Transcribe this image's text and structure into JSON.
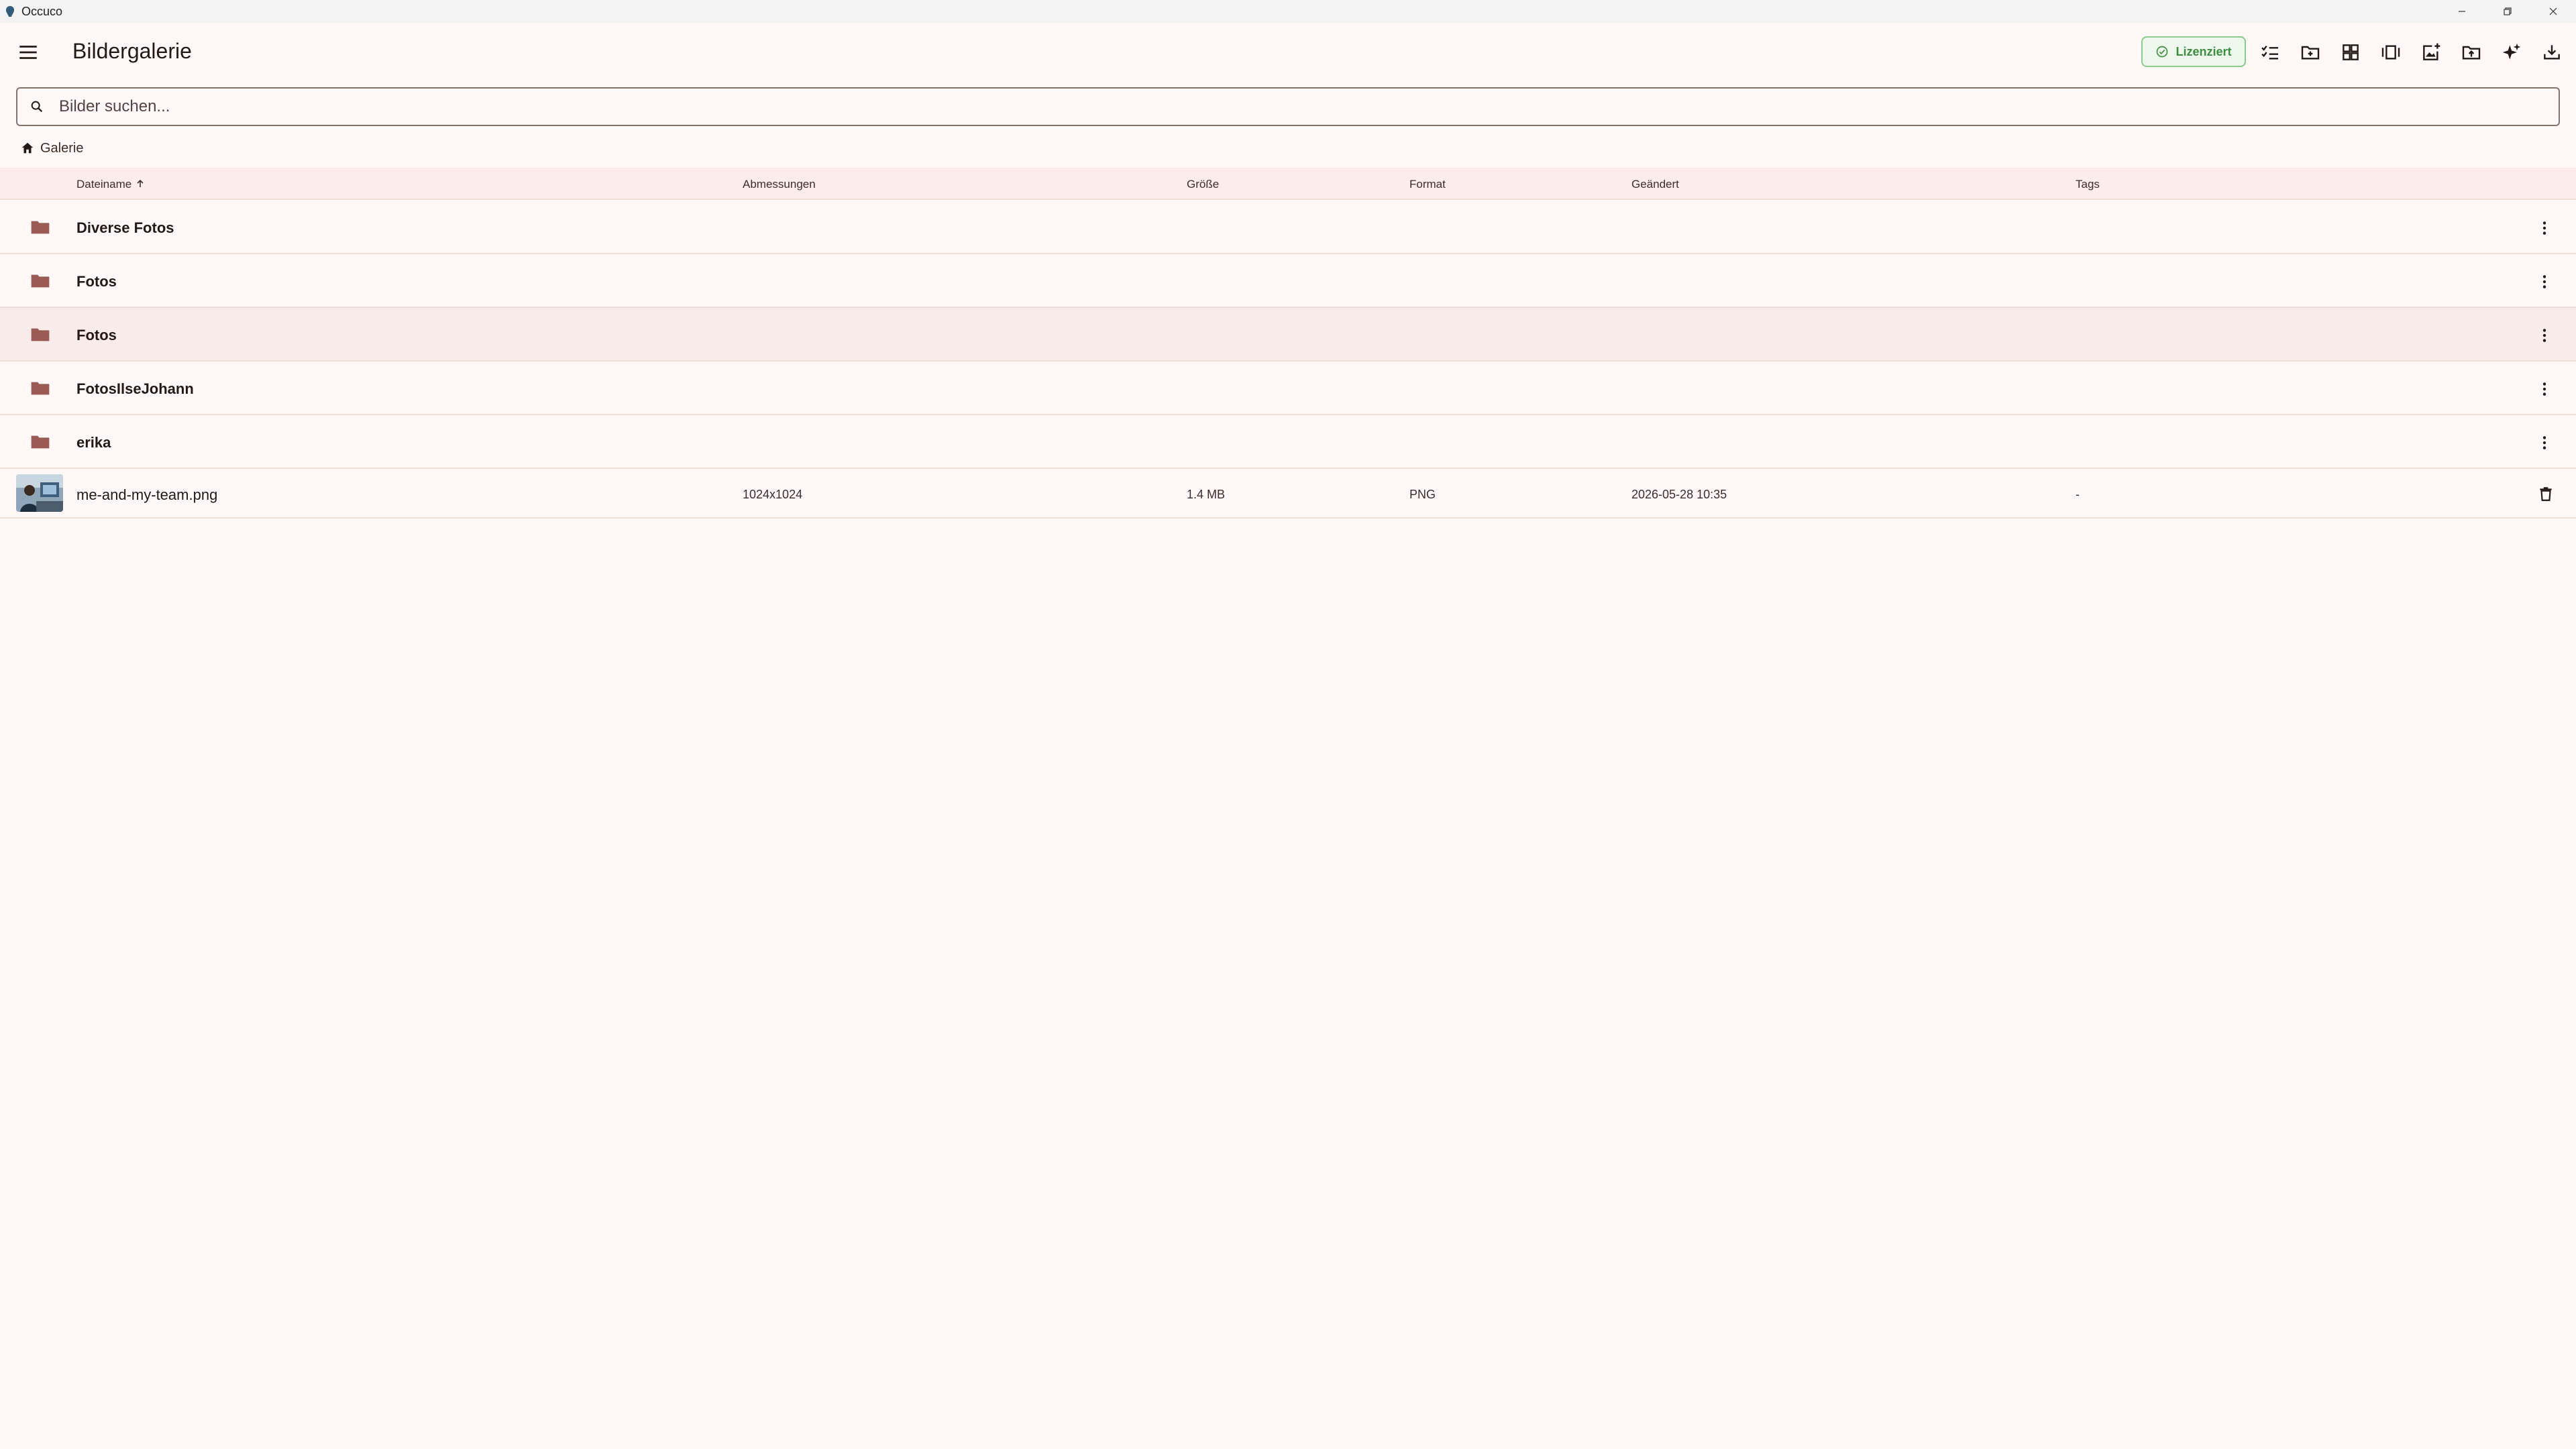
{
  "window": {
    "title": "Occuco"
  },
  "appbar": {
    "title": "Bildergalerie",
    "license_label": "Lizenziert",
    "toolbar_icons": [
      "checklist-icon",
      "new-folder-icon",
      "grid-view-icon",
      "slideshow-icon",
      "add-photo-icon",
      "upload-folder-icon",
      "ai-sparkle-icon",
      "download-icon"
    ]
  },
  "search": {
    "placeholder": "Bilder suchen..."
  },
  "breadcrumb": {
    "home_label": "Galerie"
  },
  "table": {
    "columns": {
      "name": "Dateiname",
      "dimensions": "Abmessungen",
      "size": "Größe",
      "format": "Format",
      "modified": "Geändert",
      "tags": "Tags"
    },
    "folders": [
      {
        "name": "Diverse Fotos"
      },
      {
        "name": "Fotos"
      },
      {
        "name": "Fotos"
      },
      {
        "name": "FotosIlseJohann"
      },
      {
        "name": "erika"
      }
    ],
    "files": [
      {
        "name": "me-and-my-team.png",
        "dimensions": "1024x1024",
        "size": "1.4 MB",
        "format": "PNG",
        "modified": "2026-05-28 10:35",
        "tags": "-"
      }
    ]
  },
  "colors": {
    "background": "#FFF8F6",
    "folder": "#9C5A55",
    "license_green": "#3C8E3F",
    "header_bg": "#FCEDEA"
  }
}
